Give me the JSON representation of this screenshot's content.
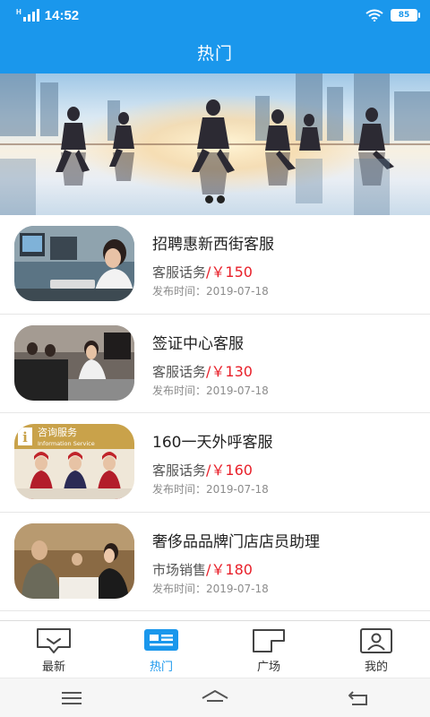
{
  "status_bar": {
    "signal": "H",
    "time": "14:52",
    "battery": "85"
  },
  "header": {
    "title": "热门"
  },
  "banner": {
    "slides": 2,
    "active_slide": 1
  },
  "jobs": [
    {
      "title": "招聘惠新西街客服",
      "category": "客服话务",
      "sep": "/",
      "price": "￥150",
      "date_label": "发布时间：",
      "date": "2019-07-18"
    },
    {
      "title": "签证中心客服",
      "category": "客服话务",
      "sep": "/",
      "price": "￥130",
      "date_label": "发布时间：",
      "date": "2019-07-18"
    },
    {
      "title": "160一天外呼客服",
      "category": "客服话务",
      "sep": "/",
      "price": "￥160",
      "date_label": "发布时间：",
      "date": "2019-07-18"
    },
    {
      "title": "奢侈品品牌门店店员助理",
      "category": "市场销售",
      "sep": "/",
      "price": "￥180",
      "date_label": "发布时间：",
      "date": "2019-07-18"
    }
  ],
  "thumb_texts": {
    "consult_sign": "咨询服务",
    "consult_sign_en": "Information Service"
  },
  "tabs": [
    {
      "label": "最新",
      "icon": "chat-bubble-icon",
      "active": false
    },
    {
      "label": "热门",
      "icon": "news-card-icon",
      "active": true
    },
    {
      "label": "广场",
      "icon": "square-icon",
      "active": false
    },
    {
      "label": "我的",
      "icon": "profile-icon",
      "active": false
    }
  ],
  "colors": {
    "primary": "#1a97ec",
    "price": "#e8202a"
  }
}
